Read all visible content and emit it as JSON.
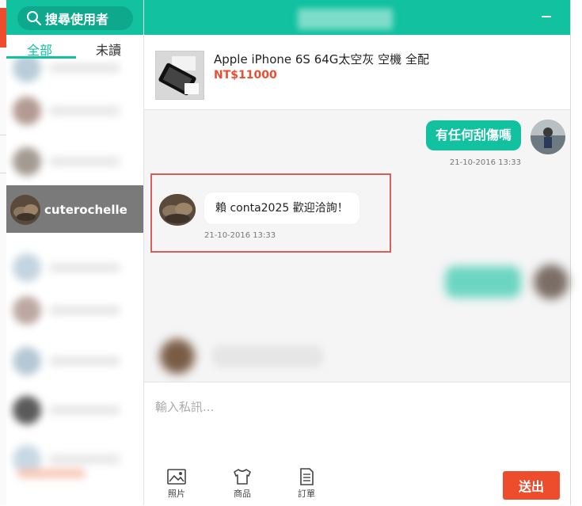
{
  "search": {
    "label": "搜尋使用者"
  },
  "tabs": {
    "all": "全部",
    "unread": "未讀"
  },
  "conversations": {
    "active_name": "cuterochelle"
  },
  "product": {
    "title": "Apple iPhone 6S 64G太空灰 空機 全配",
    "price": "NT$11000"
  },
  "messages": {
    "outgoing_text": "有任何刮傷嗎",
    "outgoing_time": "21-10-2016 13:33",
    "incoming_text": "賴 conta2025 歡迎洽詢！",
    "incoming_time": "21-10-2016 13:33"
  },
  "composer": {
    "placeholder": "輸入私訊...",
    "photo_label": "照片",
    "goods_label": "商品",
    "order_label": "訂單",
    "send_label": "送出"
  },
  "colors": {
    "accent": "#11c1a0",
    "brand": "#ee4d2d"
  },
  "icons": [
    "search-icon",
    "minimize-icon",
    "photo-icon",
    "shirt-icon",
    "order-icon"
  ]
}
